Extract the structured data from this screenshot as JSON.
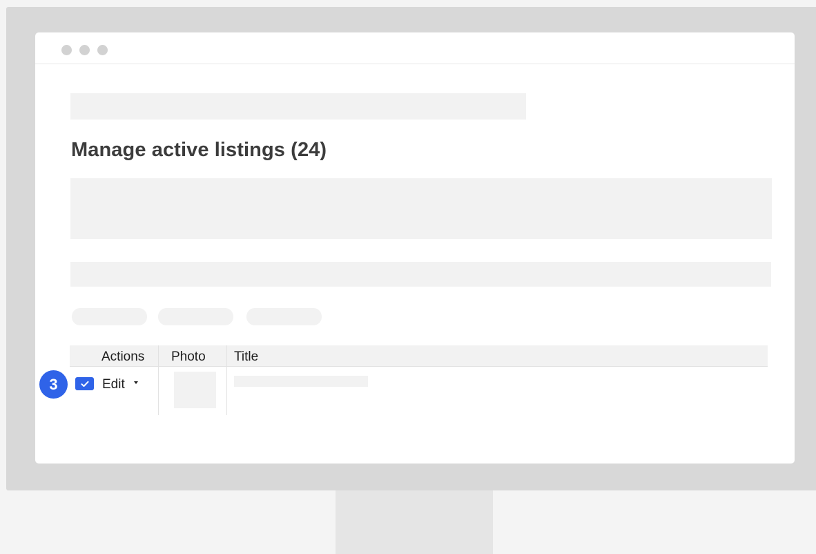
{
  "page": {
    "title": "Manage active listings (24)"
  },
  "table": {
    "headers": [
      "Actions",
      "Photo",
      "Title"
    ],
    "row": {
      "action_label": "Edit",
      "checked": true
    }
  },
  "annotation": {
    "step_number": "3"
  },
  "colors": {
    "accent": "#2f63e8",
    "placeholder": "#f2f2f2",
    "monitor": "#d8d8d8"
  },
  "icons": {
    "checkbox": "checkmark-icon",
    "dropdown": "caret-down-icon"
  }
}
